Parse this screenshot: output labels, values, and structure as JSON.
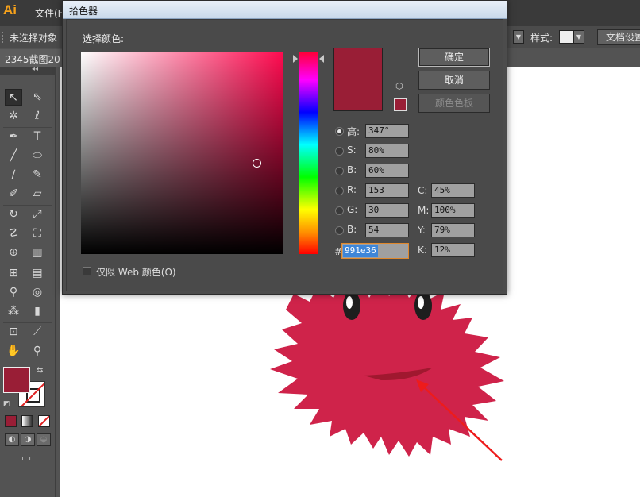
{
  "app": {
    "logo_text": "Ai",
    "menu_file": "文件(F)",
    "selection_status": "未选择对象",
    "style_label": "样式:",
    "doc_setup_button": "文档设置",
    "doc_tab_title": "2345截图20"
  },
  "dialog": {
    "title": "拾色器",
    "choose_color_label": "选择颜色:",
    "buttons": {
      "ok": "确定",
      "cancel": "取消",
      "color_swatches": "颜色色板"
    },
    "hsb": [
      {
        "label": "H:",
        "value": "347°"
      },
      {
        "label": "S:",
        "value": "80%"
      },
      {
        "label": "B:",
        "value": "60%"
      }
    ],
    "rgb": [
      {
        "label": "R:",
        "value": "153"
      },
      {
        "label": "G:",
        "value": "30"
      },
      {
        "label": "B:",
        "value": "54"
      }
    ],
    "cmyk": [
      {
        "label": "C:",
        "value": "45%"
      },
      {
        "label": "M:",
        "value": "100%"
      },
      {
        "label": "Y:",
        "value": "79%"
      },
      {
        "label": "K:",
        "value": "12%"
      }
    ],
    "hex_label": "#",
    "hex_value": "991e36",
    "hsb_h_label_text": "高:",
    "web_only_label": "仅限 Web 颜色(O)",
    "web_only_checked": false,
    "selected_radio": "H"
  },
  "colors": {
    "current": "#991e36",
    "artwork_fill": "#cf234a",
    "mouth": "#a0182f",
    "annotation_arrow": "#ee1b1b"
  },
  "icons": {
    "gamut_warning": "cube-icon",
    "selection_tool": "arrow-pointer-icon",
    "annotation": "red-arrow-annotation"
  }
}
